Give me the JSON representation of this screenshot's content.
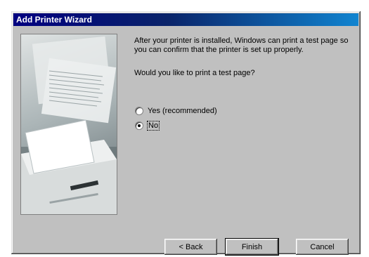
{
  "window": {
    "title": "Add Printer Wizard"
  },
  "content": {
    "description": "After your printer is installed, Windows can print a test page so you can confirm that the printer is set up properly.",
    "question": "Would you like to print a test page?",
    "options": [
      {
        "label": "Yes (recommended)",
        "accelerator": "Y",
        "selected": false
      },
      {
        "label": "No",
        "accelerator": "N",
        "selected": true
      }
    ]
  },
  "buttons": {
    "back": "< Back",
    "finish": "Finish",
    "cancel": "Cancel"
  },
  "colors": {
    "title_bar_start": "#000080",
    "title_bar_end": "#1084d0",
    "face": "#c0c0c0"
  },
  "icons": {
    "side_image": "printer-illustration"
  }
}
